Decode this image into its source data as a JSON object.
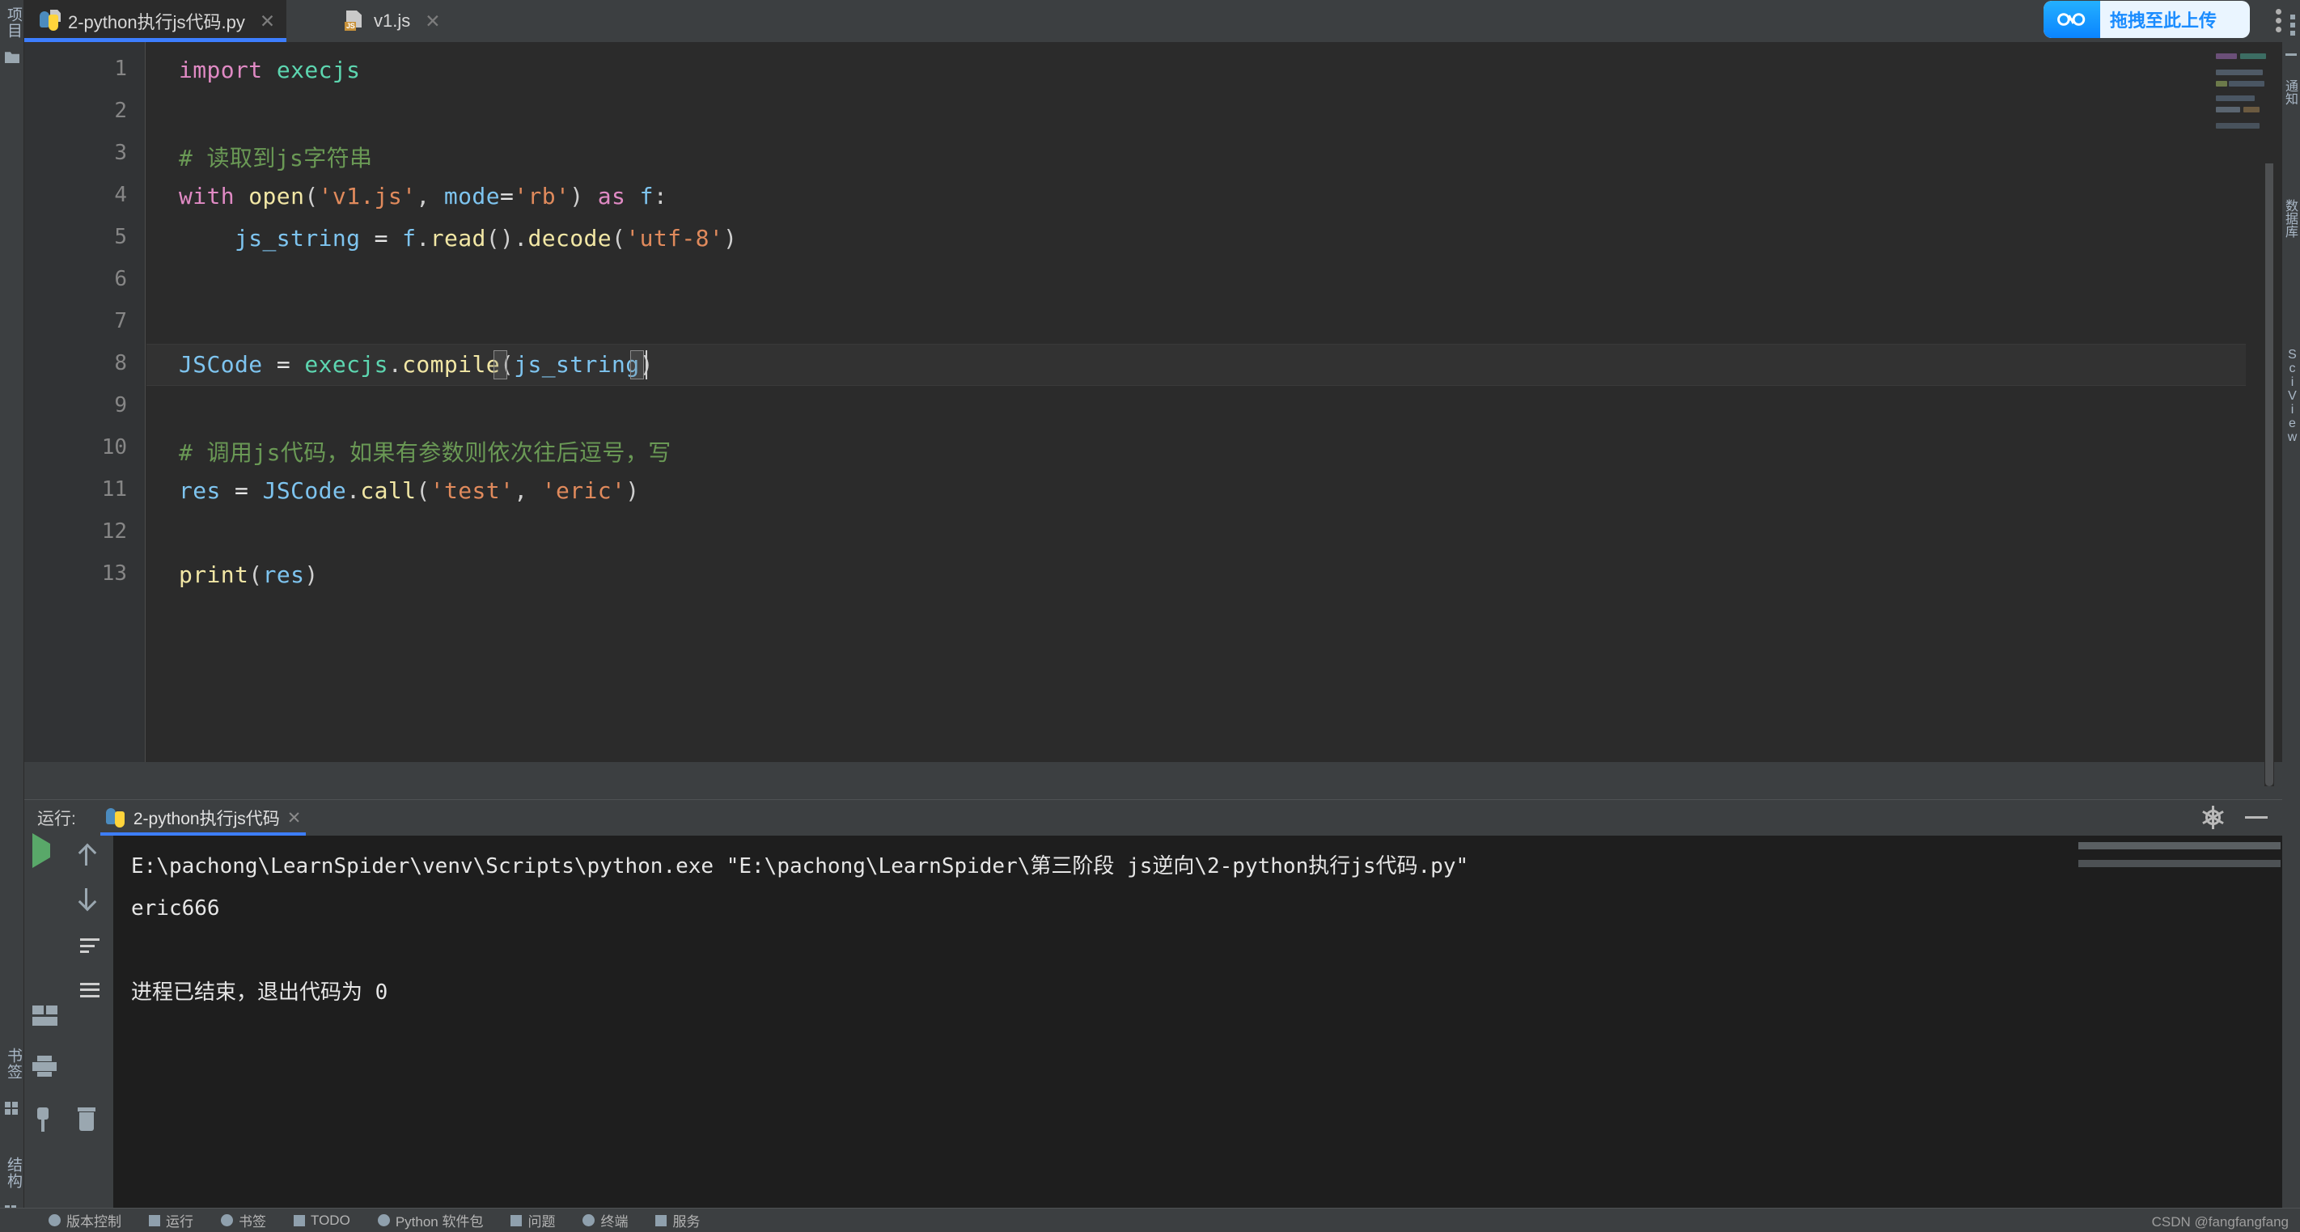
{
  "window": {
    "theme_bg": "#3c3f41",
    "editor_bg": "#2b2b2b",
    "accent": "#3d7eff"
  },
  "left_strip": {
    "project_label": "项目",
    "favorites_label": "书签",
    "structure_label": "结构"
  },
  "tabs": [
    {
      "label": "2-python执行js代码.py",
      "icon": "python-file-icon",
      "close": "✕",
      "active": true
    },
    {
      "label": "v1.js",
      "icon": "javascript-file-icon",
      "badge": "JS",
      "close": "✕",
      "active": false
    }
  ],
  "upload_widget": {
    "label": "拖拽至此上传",
    "icon": "baidu-netdisk-cloud-icon",
    "bg_color": "#eaf5ff",
    "text_color": "#1a8cff"
  },
  "window_menu": {
    "icon": "kebab-menu-icon"
  },
  "right_edge": {
    "notifications_label": "通知",
    "database_label": "数据库",
    "sciview_label": "SciView"
  },
  "editor": {
    "line_numbers": [
      "1",
      "2",
      "3",
      "4",
      "5",
      "6",
      "7",
      "8",
      "9",
      "10",
      "11",
      "12",
      "13"
    ],
    "current_line": 8,
    "lines": [
      {
        "n": 1,
        "tokens": [
          {
            "t": "import",
            "c": "kw"
          },
          {
            "t": " ",
            "c": "op"
          },
          {
            "t": "execjs",
            "c": "mod"
          }
        ]
      },
      {
        "n": 2,
        "tokens": []
      },
      {
        "n": 3,
        "tokens": [
          {
            "t": "# 读取到js字符串",
            "c": "cm"
          }
        ]
      },
      {
        "n": 4,
        "tokens": [
          {
            "t": "with",
            "c": "kw"
          },
          {
            "t": " ",
            "c": "op"
          },
          {
            "t": "open",
            "c": "fn"
          },
          {
            "t": "(",
            "c": "pn"
          },
          {
            "t": "'v1.js'",
            "c": "st"
          },
          {
            "t": ", ",
            "c": "pn"
          },
          {
            "t": "mode",
            "c": "va"
          },
          {
            "t": "=",
            "c": "op"
          },
          {
            "t": "'rb'",
            "c": "st"
          },
          {
            "t": ")",
            "c": "pn"
          },
          {
            "t": " ",
            "c": "op"
          },
          {
            "t": "as",
            "c": "kw"
          },
          {
            "t": " ",
            "c": "op"
          },
          {
            "t": "f",
            "c": "va"
          },
          {
            "t": ":",
            "c": "pn"
          }
        ]
      },
      {
        "n": 5,
        "tokens": [
          {
            "t": "    ",
            "c": "op"
          },
          {
            "t": "js_string",
            "c": "va"
          },
          {
            "t": " ",
            "c": "op"
          },
          {
            "t": "=",
            "c": "op"
          },
          {
            "t": " ",
            "c": "op"
          },
          {
            "t": "f",
            "c": "va"
          },
          {
            "t": ".",
            "c": "pn"
          },
          {
            "t": "read",
            "c": "fn"
          },
          {
            "t": "()",
            "c": "pn"
          },
          {
            "t": ".",
            "c": "pn"
          },
          {
            "t": "decode",
            "c": "fn"
          },
          {
            "t": "(",
            "c": "pn"
          },
          {
            "t": "'utf-8'",
            "c": "st"
          },
          {
            "t": ")",
            "c": "pn"
          }
        ]
      },
      {
        "n": 6,
        "tokens": []
      },
      {
        "n": 7,
        "tokens": []
      },
      {
        "n": 8,
        "tokens": [
          {
            "t": "JSCode",
            "c": "va"
          },
          {
            "t": " ",
            "c": "op"
          },
          {
            "t": "=",
            "c": "op"
          },
          {
            "t": " ",
            "c": "op"
          },
          {
            "t": "execjs",
            "c": "mod"
          },
          {
            "t": ".",
            "c": "pn"
          },
          {
            "t": "compile",
            "c": "fn"
          },
          {
            "t": "(",
            "c": "pn"
          },
          {
            "t": "js_string",
            "c": "va"
          },
          {
            "t": ")",
            "c": "pn"
          }
        ]
      },
      {
        "n": 9,
        "tokens": []
      },
      {
        "n": 10,
        "tokens": [
          {
            "t": "# 调用js代码，如果有参数则依次往后逗号，写",
            "c": "cm"
          }
        ]
      },
      {
        "n": 11,
        "tokens": [
          {
            "t": "res",
            "c": "va"
          },
          {
            "t": " ",
            "c": "op"
          },
          {
            "t": "=",
            "c": "op"
          },
          {
            "t": " ",
            "c": "op"
          },
          {
            "t": "JSCode",
            "c": "va"
          },
          {
            "t": ".",
            "c": "pn"
          },
          {
            "t": "call",
            "c": "fn"
          },
          {
            "t": "(",
            "c": "pn"
          },
          {
            "t": "'test'",
            "c": "st"
          },
          {
            "t": ", ",
            "c": "pn"
          },
          {
            "t": "'eric'",
            "c": "st"
          },
          {
            "t": ")",
            "c": "pn"
          }
        ]
      },
      {
        "n": 12,
        "tokens": []
      },
      {
        "n": 13,
        "tokens": [
          {
            "t": "print",
            "c": "fn"
          },
          {
            "t": "(",
            "c": "pn"
          },
          {
            "t": "res",
            "c": "va"
          },
          {
            "t": ")",
            "c": "pn"
          }
        ]
      }
    ],
    "inspection_status": "ok-check-icon"
  },
  "run_window": {
    "title": "运行:",
    "tab_label": "2-python执行js代码",
    "tab_close": "✕",
    "settings_icon": "gear-icon",
    "minimize_icon": "minimize-icon",
    "toolbar": [
      {
        "name": "rerun-button",
        "icon": "play-icon"
      },
      {
        "name": "configure-button",
        "icon": "wrench-icon"
      },
      {
        "name": "stop-button",
        "icon": "stop-icon"
      },
      {
        "name": "scroll-up-button",
        "icon": "arrow-up-icon"
      },
      {
        "name": "scroll-down-button",
        "icon": "arrow-down-icon"
      },
      {
        "name": "soft-wrap-button",
        "icon": "soft-wrap-icon"
      },
      {
        "name": "scroll-to-end-button",
        "icon": "scroll-end-icon"
      },
      {
        "name": "split-pane-button",
        "icon": "split-pane-icon"
      },
      {
        "name": "print-button",
        "icon": "printer-icon"
      },
      {
        "name": "pin-tab-button",
        "icon": "pin-icon"
      },
      {
        "name": "clear-all-button",
        "icon": "trash-icon"
      }
    ],
    "console_lines": [
      "E:\\pachong\\LearnSpider\\venv\\Scripts\\python.exe \"E:\\pachong\\LearnSpider\\第三阶段 js逆向\\2-python执行js代码.py\"",
      "eric666",
      "",
      "进程已结束，退出代码为 0"
    ]
  },
  "status_bar": {
    "items": [
      {
        "label": "版本控制",
        "icon": "version-control-icon"
      },
      {
        "label": "运行",
        "icon": "run-icon"
      },
      {
        "label": "书签",
        "icon": "bookmark-icon"
      },
      {
        "label": "TODO",
        "icon": "todo-icon"
      },
      {
        "label": "Python 软件包",
        "icon": "python-packages-icon"
      },
      {
        "label": "问题",
        "icon": "problems-icon"
      },
      {
        "label": "终端",
        "icon": "terminal-icon"
      },
      {
        "label": "服务",
        "icon": "services-icon"
      }
    ]
  },
  "watermark": {
    "text": "CSDN @fangfangfang"
  }
}
